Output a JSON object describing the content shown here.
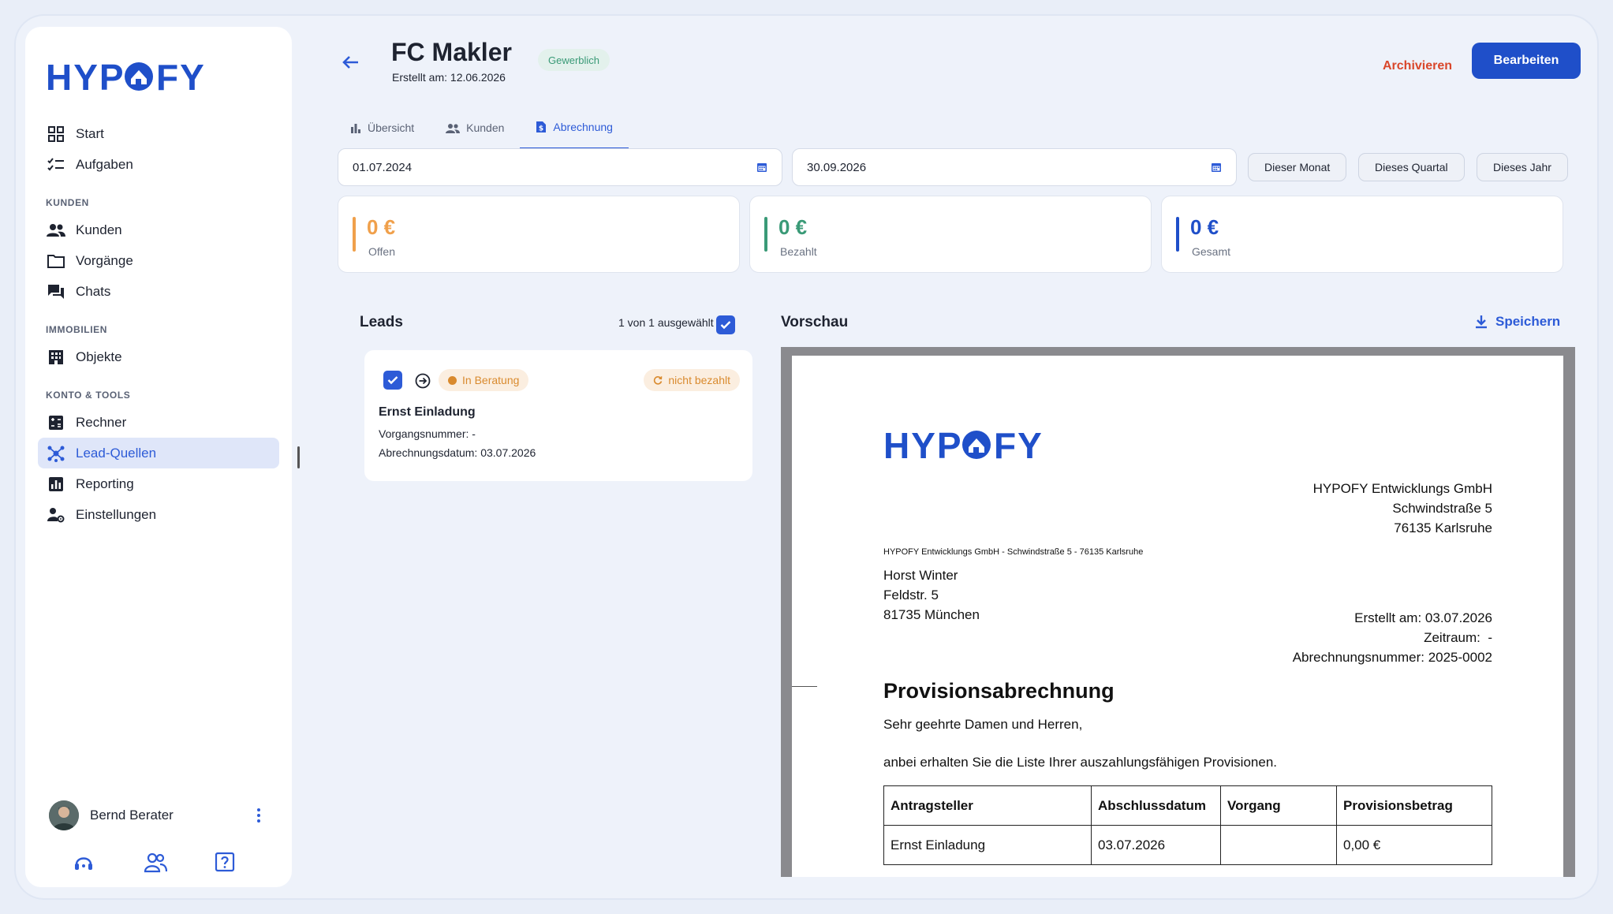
{
  "app": {
    "logo_text": "HYPOFY"
  },
  "sidebar": {
    "items_top": [
      {
        "label": "Start",
        "icon": "grid-icon"
      },
      {
        "label": "Aufgaben",
        "icon": "checklist-icon"
      }
    ],
    "section_kunden": "KUNDEN",
    "items_kunden": [
      {
        "label": "Kunden",
        "icon": "people-icon"
      },
      {
        "label": "Vorgänge",
        "icon": "folder-icon"
      },
      {
        "label": "Chats",
        "icon": "chat-icon"
      }
    ],
    "section_immobilien": "IMMOBILIEN",
    "items_immobilien": [
      {
        "label": "Objekte",
        "icon": "building-icon"
      }
    ],
    "section_konto": "KONTO & TOOLS",
    "items_konto": [
      {
        "label": "Rechner",
        "icon": "calculator-icon"
      },
      {
        "label": "Lead-Quellen",
        "icon": "hub-icon",
        "active": true
      },
      {
        "label": "Reporting",
        "icon": "chart-icon"
      },
      {
        "label": "Einstellungen",
        "icon": "user-settings-icon"
      }
    ],
    "user": {
      "name": "Bernd Berater"
    }
  },
  "header": {
    "title": "FC Makler",
    "badge": "Gewerblich",
    "created": "Erstellt am: 12.06.2026",
    "archive_label": "Archivieren",
    "edit_label": "Bearbeiten",
    "accent": "#1f4fc9",
    "danger": "#d9472b"
  },
  "tabs": [
    {
      "label": "Übersicht",
      "active": false
    },
    {
      "label": "Kunden",
      "active": false
    },
    {
      "label": "Abrechnung",
      "active": true
    }
  ],
  "filters": {
    "date_from": "01.07.2024",
    "date_to": "30.09.2026",
    "quick": [
      "Dieser Monat",
      "Dieses Quartal",
      "Dieses Jahr"
    ]
  },
  "stats": [
    {
      "value": "0 €",
      "label": "Offen",
      "color": "#f0a04b"
    },
    {
      "value": "0 €",
      "label": "Bezahlt",
      "color": "#3a9a77"
    },
    {
      "value": "0 €",
      "label": "Gesamt",
      "color": "#1f4fc9"
    }
  ],
  "leads": {
    "title": "Leads",
    "selection": "1 von 1 ausgewählt",
    "items": [
      {
        "status": "In Beratung",
        "payment": "nicht bezahlt",
        "name": "Ernst Einladung",
        "vorgang": "Vorgangsnummer: -",
        "datum": "Abrechnungsdatum: 03.07.2026"
      }
    ]
  },
  "preview": {
    "title": "Vorschau",
    "save_label": "Speichern",
    "document": {
      "logo_text": "HYPOFY",
      "sender": [
        "HYPOFY Entwicklungs GmbH",
        "Schwindstraße 5",
        "76135 Karlsruhe"
      ],
      "sender_line": "HYPOFY Entwicklungs GmbH - Schwindstraße 5 - 76135 Karlsruhe",
      "recipient": [
        "Horst Winter",
        "Feldstr. 5",
        "81735 München"
      ],
      "meta": [
        "Erstellt am: 03.07.2026",
        "Zeitraum:  -",
        "Abrechnungsnummer: 2025-0002"
      ],
      "title": "Provisionsabrechnung",
      "greeting": "Sehr geehrte Damen und Herren,",
      "intro": "anbei erhalten Sie die Liste Ihrer auszahlungsfähigen Provisionen.",
      "table": {
        "headers": [
          "Antragsteller",
          "Abschlussdatum",
          "Vorgang",
          "Provisionsbetrag"
        ],
        "rows": [
          [
            "Ernst Einladung",
            "03.07.2026",
            "",
            "0,00 €"
          ]
        ]
      }
    }
  }
}
